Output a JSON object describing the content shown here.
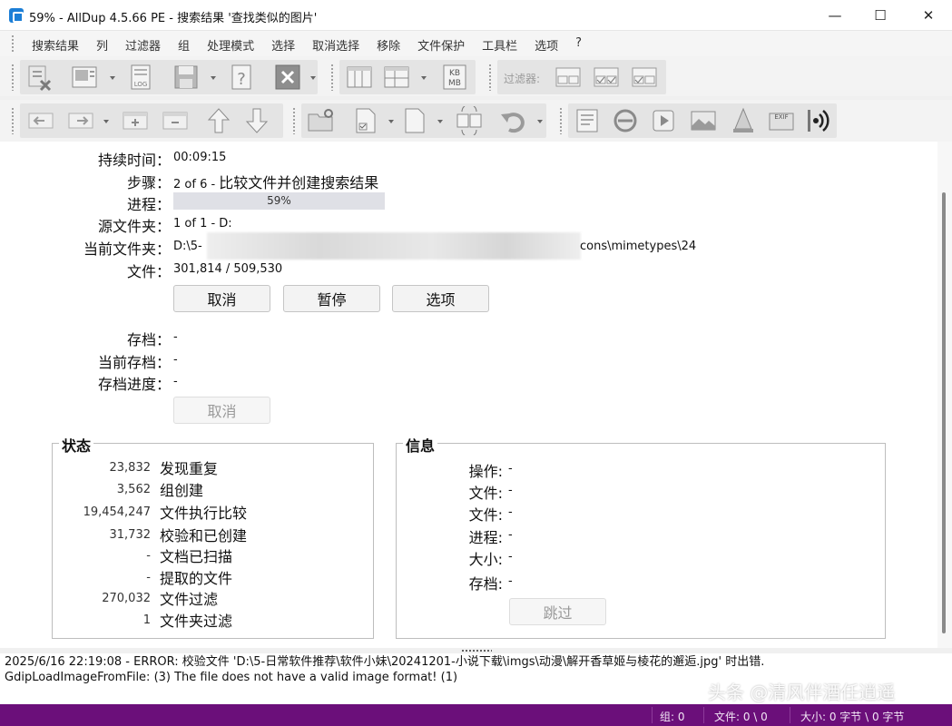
{
  "window": {
    "title": "59% - AllDup 4.5.66 PE - 搜索结果 '查找类似的图片'",
    "minimize": "—",
    "maximize": "☐",
    "close": "✕"
  },
  "menu": [
    "搜索结果",
    "列",
    "过滤器",
    "组",
    "处理模式",
    "选择",
    "取消选择",
    "移除",
    "文件保护",
    "工具栏",
    "选项",
    "?"
  ],
  "toolbar": {
    "filter_label": "过滤器:",
    "kb_label": "KB",
    "mb_label": "MB",
    "log_label": "LOG",
    "exif_label": "EXIF"
  },
  "progress_panel": {
    "duration_label": "持续时间",
    "duration_value": "00:09:15",
    "step_label": "步骤",
    "step_value_prefix": "2 of 6 - ",
    "step_value_text": "比较文件并创建搜索结果",
    "progress_label": "进程",
    "progress_text": "59%",
    "progress_fraction": 0.59,
    "source_label": "源文件夹",
    "source_value": "1 of 1 - D:",
    "current_folder_label": "当前文件夹",
    "current_folder_start": "D:\\5-",
    "current_folder_end": "cons\\mimetypes\\24",
    "file_label": "文件",
    "file_value": "301,814 / 509,530",
    "cancel": "取消",
    "pause": "暂停",
    "options": "选项",
    "archive_label": "存档",
    "archive_value": "-",
    "current_archive_label": "当前存档",
    "current_archive_value": "-",
    "archive_progress_label": "存档进度",
    "archive_progress_value": "-",
    "archive_cancel": "取消"
  },
  "status_group": {
    "title": "状态",
    "rows": [
      {
        "num": "23,832",
        "label": "发现重复"
      },
      {
        "num": "3,562",
        "label": "组创建"
      },
      {
        "num": "19,454,247",
        "label": "文件执行比较"
      },
      {
        "num": "31,732",
        "label": "校验和已创建"
      },
      {
        "num": "-",
        "label": "文档已扫描"
      },
      {
        "num": "-",
        "label": "提取的文件"
      },
      {
        "num": "270,032",
        "label": "文件过滤"
      },
      {
        "num": "1",
        "label": "文件夹过滤"
      }
    ]
  },
  "info_group": {
    "title": "信息",
    "rows": [
      {
        "label": "操作:",
        "value": "-"
      },
      {
        "label": "文件:",
        "value": "-"
      },
      {
        "label": "文件:",
        "value": "-"
      },
      {
        "label": "进程:",
        "value": "-"
      },
      {
        "label": "大小:",
        "value": "-"
      },
      {
        "label": "存档:",
        "value": "-"
      }
    ],
    "skip": "跳过"
  },
  "log": {
    "line1": "2025/6/16 22:19:08 - ERROR: 校验文件 'D:\\5-日常软件推荐\\软件小妹\\20241201-小说下载\\imgs\\动漫\\解开香草姬与棱花的邂逅.jpg' 时出错.",
    "line2": "GdipLoadImageFromFile: (3) The file does not have a valid image format! (1)"
  },
  "watermark": "头条 @清风伴酒任逍遥",
  "statusbar": {
    "groups": "组: 0",
    "files": "文件: 0 \\ 0",
    "size": "大小: 0 字节 \\ 0 字节"
  },
  "colors": {
    "statusbar_bg": "#6b0f7a",
    "progress_bg": "#dfe0e6",
    "app_icon": "#1c7ed6"
  }
}
